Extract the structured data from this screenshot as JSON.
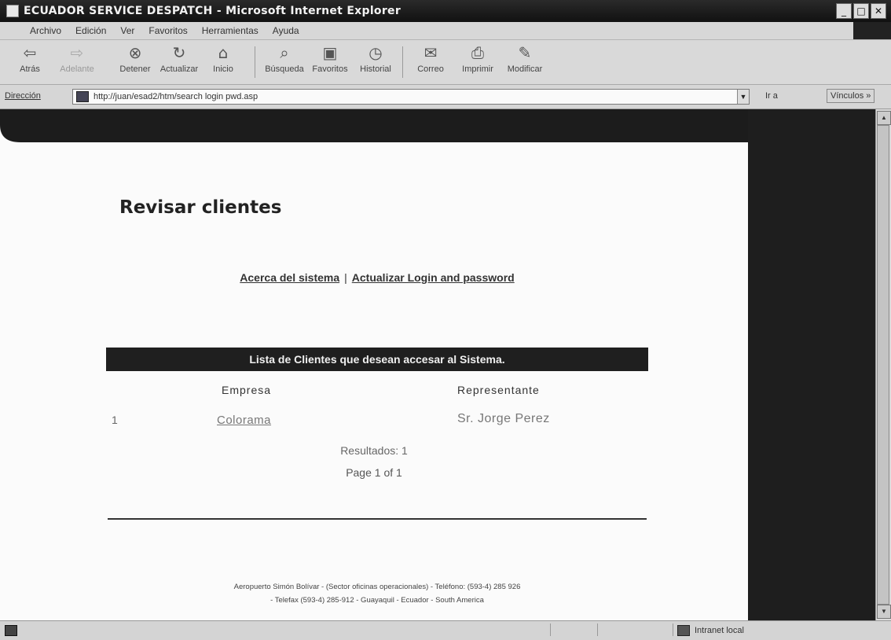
{
  "window": {
    "title": "ECUADOR SERVICE DESPATCH - Microsoft Internet Explorer",
    "controls": {
      "minimize": "_",
      "maximize": "□",
      "close": "✕"
    }
  },
  "menu": [
    "Archivo",
    "Edición",
    "Ver",
    "Favoritos",
    "Herramientas",
    "Ayuda"
  ],
  "toolbar": {
    "back": "Atrás",
    "forward": "Adelante",
    "stop": "Detener",
    "refresh": "Actualizar",
    "home": "Inicio",
    "search": "Búsqueda",
    "favorites": "Favoritos",
    "history": "Historial",
    "mail": "Correo",
    "print": "Imprimir",
    "edit": "Modificar"
  },
  "address": {
    "label": "Dirección",
    "url": "http://juan/esad2/htm/search login pwd.asp",
    "go": "Ir a",
    "links": "Vínculos »"
  },
  "page": {
    "title": "Revisar clientes",
    "nav": {
      "about": "Acerca del sistema",
      "separator": "|",
      "update": "Actualizar Login and password"
    },
    "list_header": "Lista de Clientes que desean accesar al Sistema.",
    "columns": {
      "empresa": "Empresa",
      "representante": "Representante"
    },
    "rows": [
      {
        "num": "1",
        "empresa": "Colorama",
        "representante": "Sr. Jorge Perez"
      }
    ],
    "results": "Resultados: 1",
    "pagination": "Page 1 of 1",
    "footer_line1": "Aeropuerto Simón Bolívar - (Sector oficinas operacionales) - Teléfono: (593-4) 285 926",
    "footer_line2": "- Telefax (593-4) 285-912 - Guayaquil - Ecuador - South America"
  },
  "status": {
    "zone": "Intranet local"
  }
}
